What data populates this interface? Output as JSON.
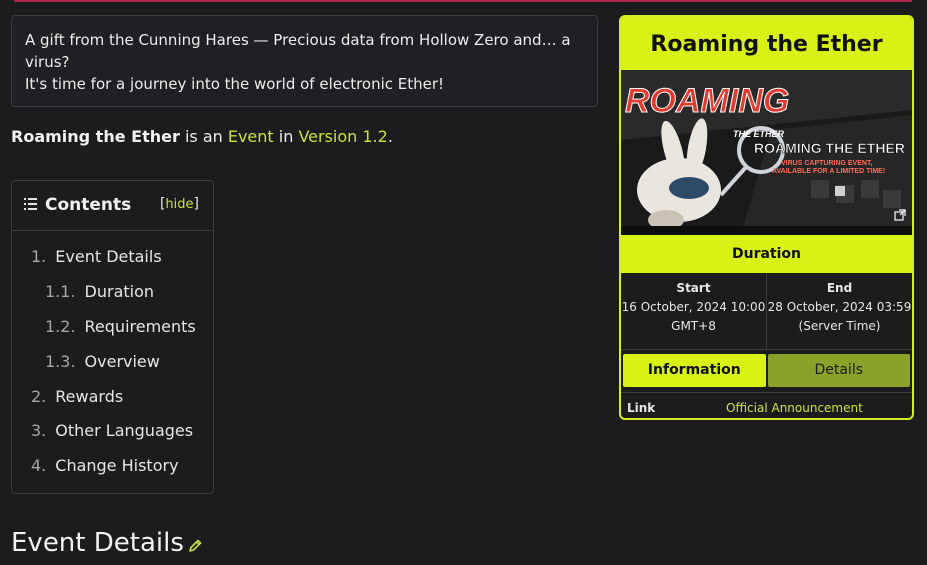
{
  "quote": {
    "line1": "A gift from the Cunning Hares — Precious data from Hollow Zero and… a virus?",
    "line2": "It's time for a journey into the world of electronic Ether!"
  },
  "intro": {
    "title": "Roaming the Ether",
    "text1": " is an ",
    "link1": "Event",
    "text2": " in ",
    "link2": "Version 1.2",
    "text3": "."
  },
  "toc": {
    "icon": "list-icon",
    "title": "Contents",
    "hide_open": "[",
    "hide": "hide",
    "hide_close": "]",
    "items": [
      {
        "num": "1.",
        "label": "Event Details"
      },
      {
        "num": "1.1.",
        "label": "Duration"
      },
      {
        "num": "1.2.",
        "label": "Requirements"
      },
      {
        "num": "1.3.",
        "label": "Overview"
      },
      {
        "num": "2.",
        "label": "Rewards"
      },
      {
        "num": "3.",
        "label": "Other Languages"
      },
      {
        "num": "4.",
        "label": "Change History"
      }
    ]
  },
  "section": {
    "heading": "Event Details",
    "edit_icon": "pencil-icon"
  },
  "infobox": {
    "title": "Roaming the Ether",
    "image": {
      "logo_text": "ROAMING",
      "small_title": "THE ETHER",
      "headline": "ROAMING THE ETHER",
      "sub1": "VIRUS CAPTURING EVENT,",
      "sub2": "AVAILABLE FOR A LIMITED TIME!",
      "expand_icon": "expand-icon"
    },
    "duration_label": "Duration",
    "start_label": "Start",
    "start_value": "16 October, 2024 10:00 GMT+8",
    "end_label": "End",
    "end_value": "28 October, 2024 03:59 (Server Time)",
    "tabs": [
      "Information",
      "Details"
    ],
    "link_label": "Link",
    "link_value": "Official Announcement",
    "accent": "#d8f117"
  }
}
